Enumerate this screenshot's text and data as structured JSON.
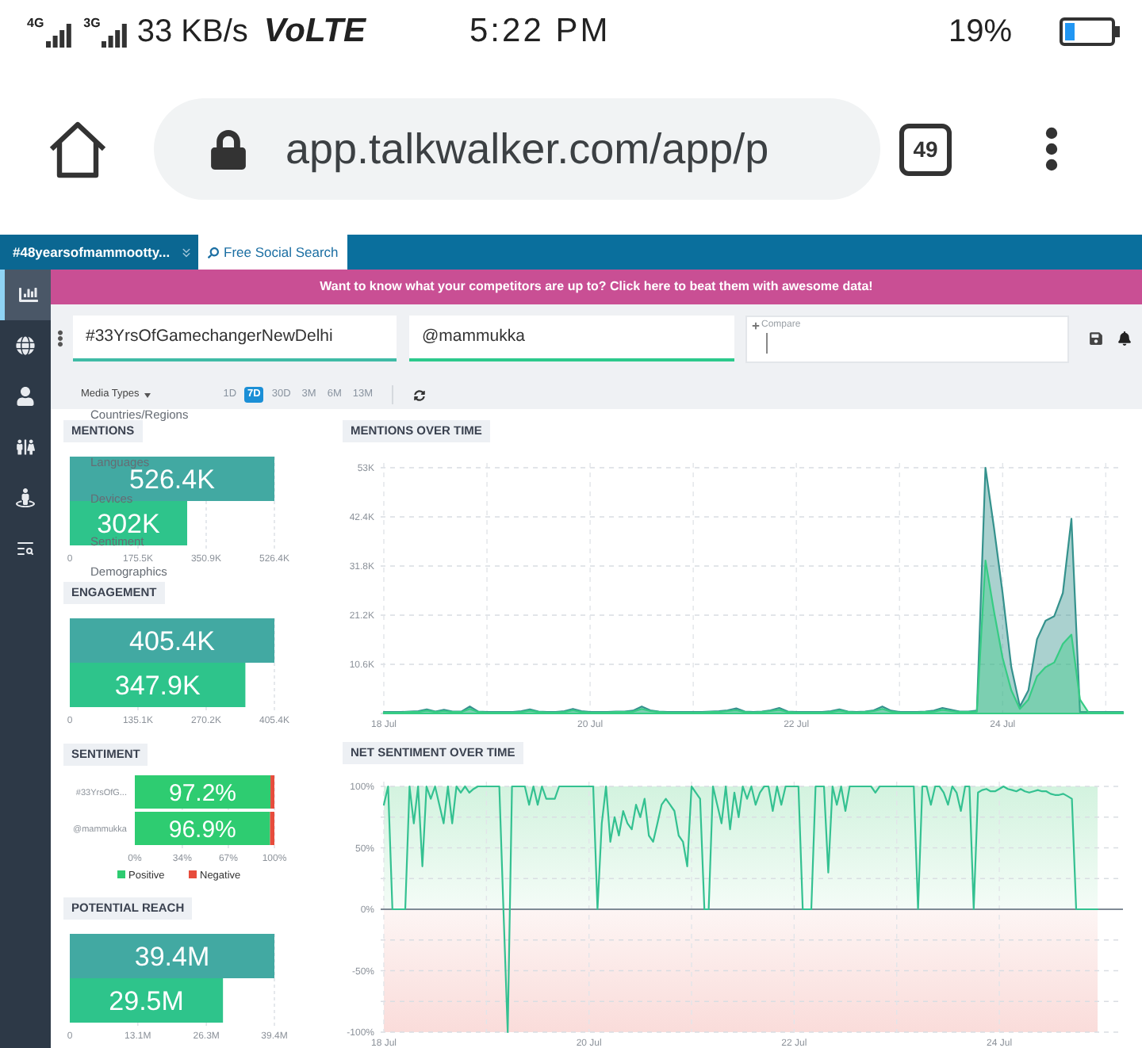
{
  "status_bar": {
    "networks": [
      {
        "label": "4G"
      },
      {
        "label": "3G"
      }
    ],
    "speed": "33 KB/s",
    "volte": "VoLTE",
    "time": "5:22 PM",
    "battery": "19%"
  },
  "browser": {
    "url": "app.talkwalker.com/app/p",
    "tab_count": "49"
  },
  "app": {
    "tabs": [
      {
        "label": "#48yearsofmammootty...",
        "selected": false,
        "kind": "project"
      },
      {
        "label": "Free Social Search",
        "selected": true,
        "kind": "search"
      }
    ],
    "sidebar": {
      "items": [
        {
          "selected": true
        },
        {
          "selected": false
        },
        {
          "selected": false
        },
        {
          "selected": false
        },
        {
          "selected": false
        },
        {
          "selected": false
        }
      ]
    },
    "banner": {
      "text": "Want to know what your competitors are up to? Click here to beat them with awesome data!"
    },
    "query_bar": {
      "queries": [
        {
          "value": "#33YrsOfGamechangerNewDelhi",
          "color": "#3fbba6"
        },
        {
          "value": "@mammukka",
          "color": "#2cc98c"
        }
      ],
      "compare": {
        "placeholder": "Compare"
      }
    },
    "filters": {
      "media_types": "Media Types",
      "ranges": [
        {
          "label": "1D",
          "selected": false
        },
        {
          "label": "7D",
          "selected": true
        },
        {
          "label": "30D",
          "selected": false
        },
        {
          "label": "3M",
          "selected": false
        },
        {
          "label": "6M",
          "selected": false
        },
        {
          "label": "13M",
          "selected": false
        }
      ]
    },
    "left_panels": [
      {
        "title": "MENTIONS",
        "chart_data": {
          "type": "bar",
          "orientation": "horizontal",
          "series": [
            {
              "color": "#42a9a2",
              "values": [
                526.4
              ]
            },
            {
              "color": "#2ec48b",
              "values": [
                302
              ]
            }
          ],
          "xlim": [
            0,
            526.4
          ],
          "xticks": [
            {
              "value": 0,
              "label": "0"
            },
            {
              "value": 175.5,
              "label": "175.5K"
            },
            {
              "value": 350.9,
              "label": "350.9K"
            },
            {
              "value": 526.4,
              "label": "526.4K"
            }
          ],
          "value_labels": [
            "526.4K",
            "302K"
          ],
          "grid": true
        }
      },
      {
        "title": "ENGAGEMENT",
        "chart_data": {
          "type": "bar",
          "orientation": "horizontal",
          "series": [
            {
              "color": "#42a9a2",
              "values": [
                405.4
              ]
            },
            {
              "color": "#2ec48b",
              "values": [
                347.9
              ]
            }
          ],
          "xlim": [
            0,
            405.4
          ],
          "xticks": [
            {
              "value": 0,
              "label": "0"
            },
            {
              "value": 135.1,
              "label": "135.1K"
            },
            {
              "value": 270.2,
              "label": "270.2K"
            },
            {
              "value": 405.4,
              "label": "405.4K"
            }
          ],
          "value_labels": [
            "405.4K",
            "347.9K"
          ],
          "grid": true
        }
      },
      {
        "title": "SENTIMENT",
        "chart_data": {
          "type": "bar",
          "orientation": "horizontal",
          "stacked": true,
          "categories": [
            "#33YrsOfG...",
            "@mammukka"
          ],
          "series": [
            {
              "name": "Positive",
              "color": "#2ecc71",
              "values": [
                97.2,
                96.9
              ]
            },
            {
              "name": "Negative",
              "color": "#e74c3c",
              "values": [
                2.8,
                3.1
              ]
            }
          ],
          "xlim": [
            0,
            100
          ],
          "xticks": [
            {
              "value": 0,
              "label": "0%"
            },
            {
              "value": 34,
              "label": "34%"
            },
            {
              "value": 67,
              "label": "67%"
            },
            {
              "value": 100,
              "label": "100%"
            }
          ],
          "value_labels": [
            "97.2%",
            "96.9%"
          ],
          "legend": "bottom",
          "grid": true
        }
      },
      {
        "title": "POTENTIAL REACH",
        "chart_data": {
          "type": "bar",
          "orientation": "horizontal",
          "series": [
            {
              "color": "#42a9a2",
              "values": [
                39.4
              ]
            },
            {
              "color": "#2ec48b",
              "values": [
                29.5
              ]
            }
          ],
          "xlim": [
            0,
            39.4
          ],
          "xticks": [
            {
              "value": 0,
              "label": "0"
            },
            {
              "value": 13.1,
              "label": "13.1M"
            },
            {
              "value": 26.3,
              "label": "26.3M"
            },
            {
              "value": 39.4,
              "label": "39.4M"
            }
          ],
          "value_labels": [
            "39.4M",
            "29.5M"
          ],
          "grid": true
        }
      }
    ],
    "overlay_menu": {
      "items": [
        "Countries/Regions",
        "Languages",
        "Devices",
        "Sentiment",
        "Demographics"
      ]
    },
    "right_panels": [
      {
        "title": "MENTIONS OVER TIME",
        "chart_data": {
          "type": "area",
          "stacked": false,
          "grid": true,
          "categories": [
            "18 Jul",
            null,
            null,
            null,
            null,
            null,
            null,
            null,
            null,
            null,
            null,
            null,
            null,
            null,
            null,
            null,
            null,
            null,
            null,
            null,
            null,
            null,
            null,
            null,
            "20 Jul",
            null,
            null,
            null,
            null,
            null,
            null,
            null,
            null,
            null,
            null,
            null,
            null,
            null,
            null,
            null,
            null,
            null,
            null,
            null,
            null,
            null,
            null,
            null,
            "22 Jul",
            null,
            null,
            null,
            null,
            null,
            null,
            null,
            null,
            null,
            null,
            null,
            null,
            null,
            null,
            null,
            null,
            null,
            null,
            null,
            null,
            null,
            null,
            null,
            "24 Jul",
            null,
            null,
            null,
            null,
            null,
            null,
            null,
            null,
            null,
            null,
            null,
            null,
            null,
            null
          ],
          "series": [
            {
              "color": "#35928d",
              "values": [
                300,
                300,
                300,
                400,
                500,
                900,
                400,
                800,
                400,
                400,
                1500,
                400,
                300,
                300,
                300,
                300,
                500,
                900,
                400,
                300,
                300,
                500,
                1000,
                500,
                300,
                300,
                300,
                400,
                400,
                600,
                1500,
                700,
                400,
                300,
                300,
                300,
                300,
                300,
                400,
                500,
                700,
                1100,
                400,
                300,
                400,
                700,
                1200,
                400,
                300,
                300,
                300,
                300,
                500,
                900,
                400,
                300,
                400,
                700,
                1500,
                600,
                300,
                300,
                300,
                400,
                600,
                1200,
                800,
                400,
                400,
                600,
                53000,
                40000,
                26000,
                10000,
                1500,
                5000,
                16000,
                20000,
                21000,
                26000,
                42000,
                300,
                300,
                300,
                300,
                300,
                300
              ]
            },
            {
              "color": "#36cc84",
              "values": [
                200,
                200,
                200,
                300,
                300,
                600,
                300,
                500,
                300,
                300,
                1000,
                300,
                200,
                200,
                200,
                200,
                300,
                600,
                300,
                200,
                200,
                300,
                700,
                300,
                200,
                200,
                200,
                300,
                300,
                400,
                1000,
                500,
                300,
                200,
                200,
                200,
                200,
                200,
                300,
                300,
                500,
                700,
                300,
                200,
                300,
                500,
                800,
                300,
                200,
                200,
                200,
                200,
                300,
                600,
                300,
                200,
                300,
                500,
                1000,
                400,
                200,
                200,
                200,
                300,
                400,
                800,
                500,
                300,
                300,
                400,
                33000,
                22000,
                12000,
                5000,
                1000,
                3000,
                8000,
                10000,
                11000,
                15000,
                17000,
                3000,
                200,
                200,
                200,
                200,
                200
              ]
            }
          ],
          "ylim": [
            0,
            53000
          ],
          "yticks": [
            {
              "value": 10600,
              "label": "10.6K"
            },
            {
              "value": 21200,
              "label": "21.2K"
            },
            {
              "value": 31800,
              "label": "31.8K"
            },
            {
              "value": 42400,
              "label": "42.4K"
            },
            {
              "value": 53000,
              "label": "53K"
            }
          ]
        }
      },
      {
        "title": "NET SENTIMENT OVER TIME",
        "chart_data": {
          "type": "line",
          "grid": true,
          "categories": [
            "18 Jul",
            null,
            null,
            null,
            null,
            null,
            null,
            null,
            null,
            null,
            null,
            null,
            null,
            null,
            null,
            null,
            null,
            null,
            null,
            null,
            null,
            null,
            null,
            null,
            null,
            null,
            null,
            null,
            null,
            null,
            null,
            null,
            null,
            null,
            null,
            null,
            null,
            null,
            null,
            null,
            null,
            null,
            null,
            null,
            null,
            null,
            null,
            null,
            "20 Jul",
            null,
            null,
            null,
            null,
            null,
            null,
            null,
            null,
            null,
            null,
            null,
            null,
            null,
            null,
            null,
            null,
            null,
            null,
            null,
            null,
            null,
            null,
            null,
            null,
            null,
            null,
            null,
            null,
            null,
            null,
            null,
            null,
            null,
            null,
            null,
            null,
            null,
            null,
            null,
            null,
            null,
            null,
            null,
            null,
            null,
            null,
            null,
            "22 Jul",
            null,
            null,
            null,
            null,
            null,
            null,
            null,
            null,
            null,
            null,
            null,
            null,
            null,
            null,
            null,
            null,
            null,
            null,
            null,
            null,
            null,
            null,
            null,
            null,
            null,
            null,
            null,
            null,
            null,
            null,
            null,
            null,
            null,
            null,
            null,
            null,
            null,
            null,
            null,
            null,
            null,
            null,
            null,
            null,
            null,
            null,
            null,
            "24 Jul",
            null,
            null,
            null,
            null,
            null,
            null,
            null,
            null,
            null,
            null,
            null,
            null,
            null,
            null,
            null,
            null,
            null,
            null,
            null,
            null,
            null,
            null,
            null
          ],
          "series": [
            {
              "color": "#34c191",
              "values": [
                85,
                100,
                0,
                0,
                0,
                0,
                100,
                70,
                100,
                35,
                100,
                90,
                100,
                85,
                70,
                100,
                70,
                100,
                95,
                100,
                95,
                98,
                100,
                100,
                100,
                100,
                100,
                100,
                0,
                -100,
                100,
                100,
                100,
                100,
                85,
                100,
                85,
                100,
                90,
                90,
                90,
                100,
                100,
                100,
                100,
                100,
                100,
                100,
                100,
                100,
                0,
                70,
                100,
                55,
                75,
                60,
                80,
                70,
                65,
                85,
                75,
                90,
                60,
                55,
                70,
                85,
                90,
                85,
                80,
                60,
                55,
                35,
                100,
                95,
                90,
                0,
                0,
                100,
                85,
                70,
                100,
                65,
                95,
                75,
                100,
                90,
                100,
                85,
                95,
                100,
                100,
                80,
                100,
                85,
                100,
                100,
                100,
                100,
                0,
                0,
                0,
                100,
                100,
                100,
                30,
                100,
                85,
                100,
                80,
                100,
                100,
                100,
                100,
                100,
                100,
                95,
                100,
                100,
                100,
                100,
                100,
                100,
                100,
                100,
                100,
                0,
                100,
                100,
                85,
                100,
                100,
                95,
                85,
                100,
                95,
                80,
                100,
                100,
                0,
                95,
                97,
                98,
                96,
                96,
                98,
                100,
                98,
                97,
                96,
                98,
                96,
                95,
                96,
                97,
                96,
                96,
                94,
                93,
                93,
                94,
                92,
                90,
                0,
                0,
                0,
                0,
                0,
                0
              ]
            }
          ],
          "ylim": [
            -100,
            100
          ],
          "yticks": [
            {
              "value": 100,
              "label": "100%"
            },
            {
              "value": 50,
              "label": "50%"
            },
            {
              "value": 0,
              "label": "0%"
            },
            {
              "value": -50,
              "label": "-50%"
            },
            {
              "value": -100,
              "label": "-100%"
            }
          ]
        }
      }
    ]
  }
}
